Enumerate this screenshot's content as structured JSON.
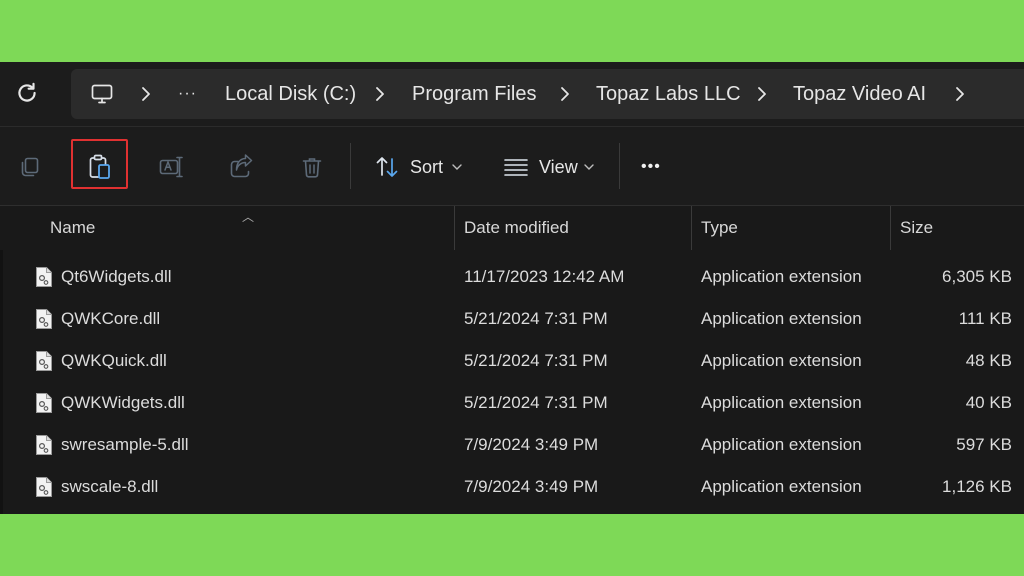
{
  "colors": {
    "background": "#7ed957",
    "window": "#191919",
    "highlight": "#e03131"
  },
  "address": {
    "crumbs": [
      "Local Disk (C:)",
      "Program Files",
      "Topaz Labs LLC",
      "Topaz Video AI"
    ],
    "ellipsis": "···"
  },
  "toolbar": {
    "sort_label": "Sort",
    "view_label": "View",
    "more_label": "•••"
  },
  "columns": {
    "name": "Name",
    "date": "Date modified",
    "type": "Type",
    "size": "Size"
  },
  "files": [
    {
      "name": "Qt6Widgets.dll",
      "date": "11/17/2023 12:42 AM",
      "type": "Application extension",
      "size": "6,305 KB"
    },
    {
      "name": "QWKCore.dll",
      "date": "5/21/2024 7:31 PM",
      "type": "Application extension",
      "size": "111 KB"
    },
    {
      "name": "QWKQuick.dll",
      "date": "5/21/2024 7:31 PM",
      "type": "Application extension",
      "size": "48 KB"
    },
    {
      "name": "QWKWidgets.dll",
      "date": "5/21/2024 7:31 PM",
      "type": "Application extension",
      "size": "40 KB"
    },
    {
      "name": "swresample-5.dll",
      "date": "7/9/2024 3:49 PM",
      "type": "Application extension",
      "size": "597 KB"
    },
    {
      "name": "swscale-8.dll",
      "date": "7/9/2024 3:49 PM",
      "type": "Application extension",
      "size": "1,126 KB"
    }
  ]
}
